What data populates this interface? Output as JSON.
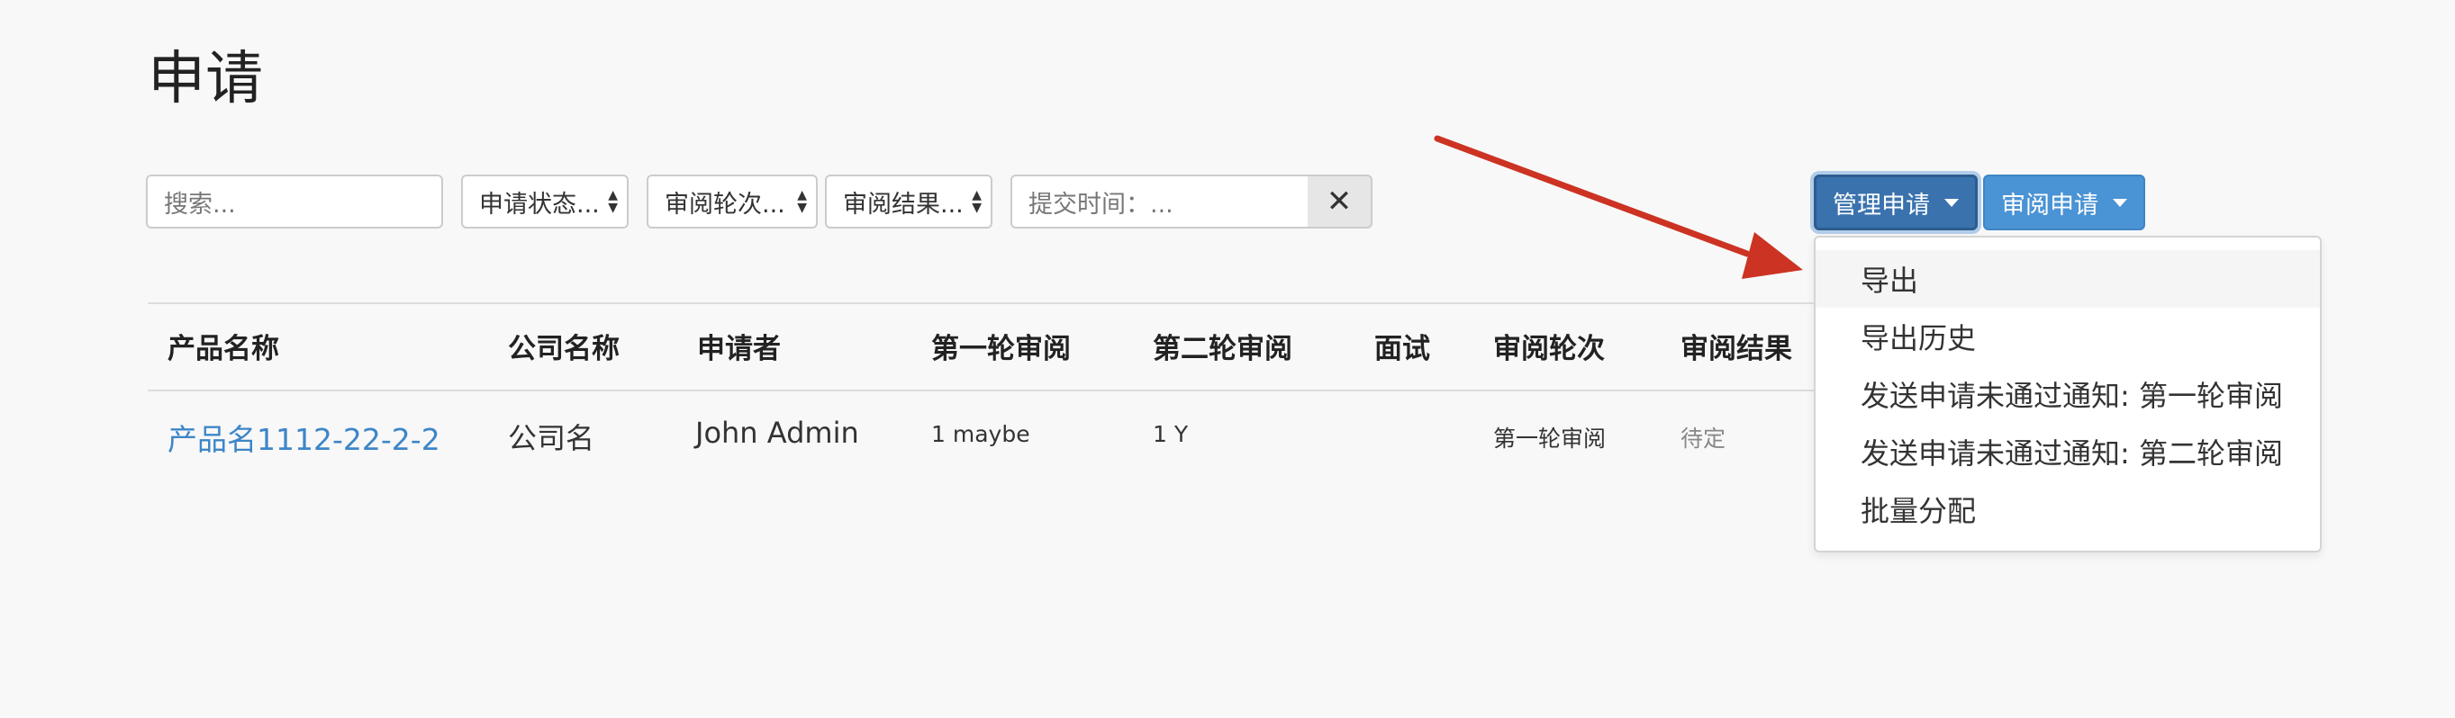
{
  "page": {
    "title": "申请"
  },
  "filters": {
    "search_placeholder": "搜索...",
    "status_select": "申请状态...",
    "round_select": "审阅轮次...",
    "result_select": "审阅结果...",
    "submit_time_placeholder": "提交时间：...",
    "clear_icon": "times-icon"
  },
  "actions": {
    "manage_label": "管理申请",
    "review_label": "审阅申请"
  },
  "dropdown": {
    "items": [
      "导出",
      "导出历史",
      "发送申请未通过通知: 第一轮审阅",
      "发送申请未通过通知: 第二轮审阅",
      "批量分配"
    ]
  },
  "table": {
    "headers": [
      "产品名称",
      "公司名称",
      "申请者",
      "第一轮审阅",
      "第二轮审阅",
      "面试",
      "审阅轮次",
      "审阅结果"
    ],
    "rows": [
      {
        "product": "产品名1112-22-2-2",
        "company": "公司名",
        "applicant": "John Admin",
        "round1": "1 maybe",
        "round2": "1 Y",
        "interview": "",
        "round": "第一轮审阅",
        "result": "待定"
      }
    ]
  },
  "colors": {
    "link": "#3d86c8",
    "primary_dark": "#3a72ae",
    "primary": "#4a93d4",
    "annotation_arrow": "#cc3322"
  }
}
